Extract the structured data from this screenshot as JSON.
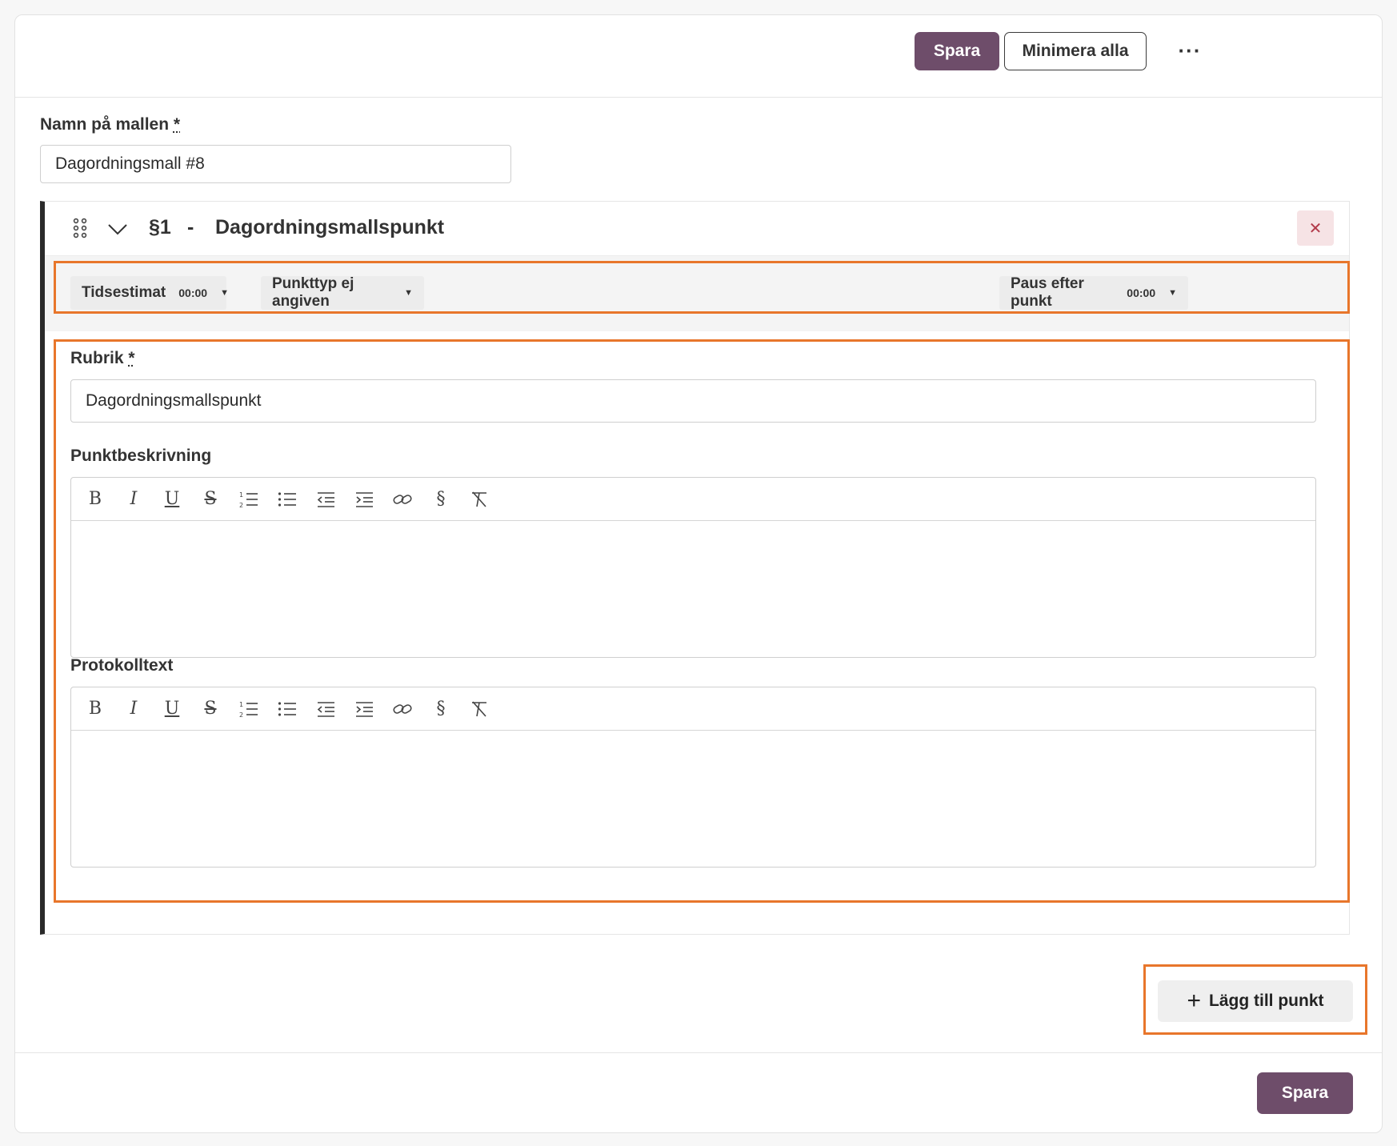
{
  "toolbar": {
    "save_label": "Spara",
    "minimize_label": "Minimera alla",
    "more_label": "···"
  },
  "template": {
    "name_label": "Namn på mallen",
    "required_mark": "*",
    "name_value": "Dagordningsmall #8"
  },
  "agenda_item": {
    "number": "§1",
    "separator": "-",
    "title": "Dagordningsmallspunkt",
    "close_label": "✕",
    "time_estimate_label": "Tidsestimat",
    "time_estimate_value": "00:00",
    "point_type_label": "Punkttyp ej angiven",
    "pause_label": "Paus efter punkt",
    "pause_value": "00:00",
    "heading_label": "Rubrik",
    "heading_value": "Dagordningsmallspunkt",
    "description_label": "Punktbeskrivning",
    "protocol_label": "Protokolltext"
  },
  "editor_toolbar": [
    "bold-icon",
    "italic-icon",
    "underline-icon",
    "strikethrough-icon",
    "ordered-list-icon",
    "bullet-list-icon",
    "outdent-icon",
    "indent-icon",
    "link-icon",
    "section-icon",
    "clear-format-icon"
  ],
  "add_point_label": "Lägg till punkt",
  "footer": {
    "save_label": "Spara"
  },
  "colors": {
    "primary": "#6e4d6a",
    "highlight": "#e8762b",
    "danger_bg": "#f6e3e5"
  }
}
